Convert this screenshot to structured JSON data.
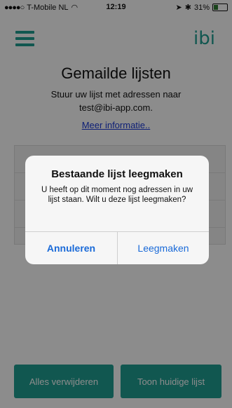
{
  "status_bar": {
    "carrier": "T-Mobile NL",
    "time": "12:19",
    "battery": "31%"
  },
  "nav": {
    "logo": "ibi"
  },
  "page": {
    "title": "Gemailde lijsten",
    "subtitle_line1": "Stuur uw lijst met adressen naar",
    "subtitle_line2": "test@ibi-app.com.",
    "info_link": "Meer informatie.."
  },
  "buttons": {
    "delete_all": "Alles verwijderen",
    "show_current": "Toon huidige lijst"
  },
  "dialog": {
    "title": "Bestaande lijst leegmaken",
    "message": "U heeft op dit moment nog adressen in uw lijst staan. Wilt u deze lijst leegmaken?",
    "cancel": "Annuleren",
    "confirm": "Leegmaken"
  },
  "colors": {
    "accent": "#1f9e93",
    "link": "#1a3ad8",
    "dialog_button": "#1a6ad8"
  }
}
